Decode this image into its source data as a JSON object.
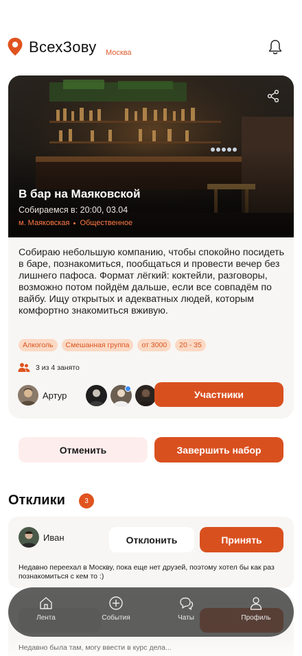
{
  "header": {
    "brand": "ВсехЗову",
    "city": "Москва",
    "logo_icon": "location-pin-icon",
    "bell_icon": "bell-icon"
  },
  "event": {
    "title": "В бар на Маяковской",
    "time": "Собираемся в: 20:00, 03.04",
    "tags": [
      "м. Маяковская",
      "Общественное"
    ],
    "description": "Собираю небольшую компанию, чтобы спокойно посидеть в баре, познакомиться, пообщаться и провести вечер без лишнего пафоса. Формат лёгкий: коктейли, разговоры, возможно потом пойдём дальше, если все совпадём по вайбу. Ищу открытых и адекватных людей, которым комфортно знакомиться вживую.",
    "chips": [
      "Алкоголь",
      "Смешанная группа",
      "от 3000",
      "20 - 35"
    ],
    "occupancy": "3 из 4 занято",
    "host_name": "Артур",
    "participants_button": "Участники"
  },
  "actions": {
    "cancel": "Отменить",
    "finish": "Завершить набор"
  },
  "responses": {
    "title": "Отклики",
    "count": "3",
    "items": [
      {
        "name": "Иван",
        "decline": "Отклонить",
        "accept": "Принять",
        "text": "Недавно переехал в Москву, пока еще нет друзей, поэтому хотел бы как раз познакомиться с кем то :)"
      },
      {
        "text": "Недавно была там, могу ввести в курс дела..."
      }
    ]
  },
  "nav": {
    "items": [
      {
        "label": "Лента",
        "icon": "home-icon"
      },
      {
        "label": "События",
        "icon": "plus-circle-icon"
      },
      {
        "label": "Чаты",
        "icon": "chat-icon"
      },
      {
        "label": "Профиль",
        "icon": "user-icon"
      }
    ]
  },
  "colors": {
    "accent": "#d9501f",
    "chip_bg": "#fbd9c4",
    "card_bg": "#f7f6f4",
    "cancel_bg": "#fdeeed"
  }
}
